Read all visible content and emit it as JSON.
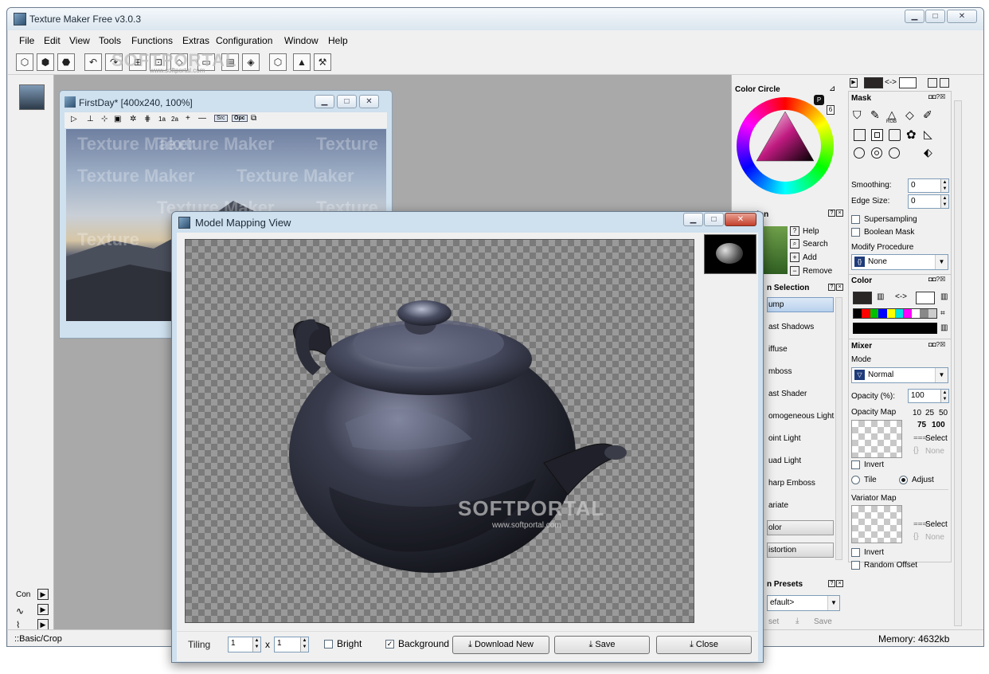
{
  "app": {
    "title": "Texture Maker Free v3.0.3"
  },
  "menu": [
    "File",
    "Edit",
    "View",
    "Tools",
    "Functions",
    "Extras",
    "Configuration",
    "Window",
    "Help"
  ],
  "status": {
    "left": "::Basic/Crop",
    "memory": "Memory: 4632kb"
  },
  "left_strip": {
    "items": [
      "Con"
    ]
  },
  "doc_window": {
    "title": "FirstDay* [400x240, 100%]",
    "btn_src": "Src",
    "btn_opc": "Opc",
    "tb_1a": "1a",
    "tb_2a": "2a",
    "watermark": [
      "Texture Maker",
      "Texture Maker",
      "Texture",
      "Texture Maker",
      "Texture Maker",
      "Texture Maker",
      "Texture",
      "Texture"
    ]
  },
  "model_window": {
    "title": "Model Mapping View",
    "watermark_brand": "SOFTPORTAL",
    "watermark_url": "www.softportal.com",
    "tiling_label": "Tiling",
    "tiling_x": "1",
    "tiling_sep": "x",
    "tiling_y": "1",
    "bright_label": "Bright",
    "bright_checked": false,
    "background_label": "Background",
    "background_checked": true,
    "download_label": "Download New",
    "save_label": "Save",
    "close_label": "Close"
  },
  "top_watermark": {
    "brand": "SOFTPORTAL",
    "url": "www.softportal.com"
  },
  "color_circle": {
    "title": "Color Circle",
    "badge_p": "P",
    "badge_num": "6"
  },
  "function_panel": {
    "title": "Function",
    "help": "Help",
    "search": "Search",
    "add": "Add",
    "remove": "Remove",
    "selection_title": "n Selection",
    "items": [
      "ump",
      "ast Shadows",
      "iffuse",
      "mboss",
      "ast Shader",
      "omogeneous Light",
      "oint Light",
      "uad Light",
      "harp Emboss",
      "ariate",
      "olor",
      "istortion"
    ],
    "presets_title": "n Presets",
    "preset_value": "efault>",
    "preset_reset": "set",
    "preset_save": "Save"
  },
  "mask_panel": {
    "title": "Mask",
    "rgb_label": "RGB",
    "smoothing_label": "Smoothing:",
    "smoothing_value": "0",
    "edge_label": "Edge Size:",
    "edge_value": "0",
    "supersampling": "Supersampling",
    "boolean": "Boolean Mask",
    "modify_label": "Modify Procedure",
    "modify_value": "None"
  },
  "swap_label": "<->",
  "color_panel": {
    "title": "Color",
    "swap": "<->",
    "palette": [
      "#000000",
      "#ff0000",
      "#00c000",
      "#0000ff",
      "#ffff00",
      "#00e0e0",
      "#ff00ff",
      "#ffffff",
      "#888888",
      "#cccccc"
    ]
  },
  "mixer_panel": {
    "title": "Mixer",
    "mode_label": "Mode",
    "mode_value": "Normal",
    "opacity_label": "Opacity (%):",
    "opacity_value": "100",
    "opacity_map_label": "Opacity Map",
    "presets_row1": [
      "10",
      "25",
      "50"
    ],
    "presets_row2": [
      "75",
      "100"
    ],
    "select": "Select",
    "none": "None",
    "invert": "Invert",
    "tile": "Tile",
    "adjust": "Adjust",
    "variator_label": "Variator Map",
    "select2": "Select",
    "none2": "None",
    "invert2": "Invert",
    "random_offset": "Random Offset"
  },
  "colors": {
    "accent": "#1e5aa8",
    "close_btn": "#c3402b",
    "swatch_dark": "#2a2626"
  }
}
